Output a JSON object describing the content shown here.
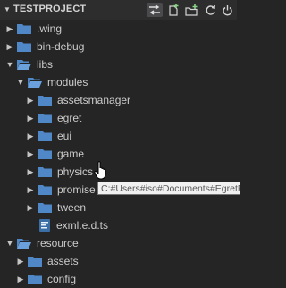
{
  "explorer": {
    "project_title": "TESTPROJECT",
    "toolbar_icons": [
      "collapse-all-icon",
      "new-file-icon",
      "new-folder-icon",
      "refresh-icon",
      "power-icon"
    ],
    "colors": {
      "folder": "#4f87c7",
      "background": "#252526",
      "text": "#cccccc"
    }
  },
  "tree": [
    {
      "label": ".wing",
      "expanded": false,
      "type": "folder"
    },
    {
      "label": "bin-debug",
      "expanded": false,
      "type": "folder"
    },
    {
      "label": "libs",
      "expanded": true,
      "type": "folder"
    },
    {
      "label": "modules",
      "expanded": true,
      "type": "folder"
    },
    {
      "label": "assetsmanager",
      "expanded": false,
      "type": "folder"
    },
    {
      "label": "egret",
      "expanded": false,
      "type": "folder"
    },
    {
      "label": "eui",
      "expanded": false,
      "type": "folder"
    },
    {
      "label": "game",
      "expanded": false,
      "type": "folder"
    },
    {
      "label": "physics",
      "expanded": false,
      "type": "folder"
    },
    {
      "label": "promise",
      "expanded": false,
      "type": "folder"
    },
    {
      "label": "tween",
      "expanded": false,
      "type": "folder"
    },
    {
      "label": "exml.e.d.ts",
      "type": "file"
    },
    {
      "label": "resource",
      "expanded": true,
      "type": "folder"
    },
    {
      "label": "assets",
      "expanded": false,
      "type": "folder"
    },
    {
      "label": "config",
      "expanded": false,
      "type": "folder"
    }
  ],
  "tooltip": {
    "text": "C:#Users#iso#Documents#EgretProj"
  }
}
